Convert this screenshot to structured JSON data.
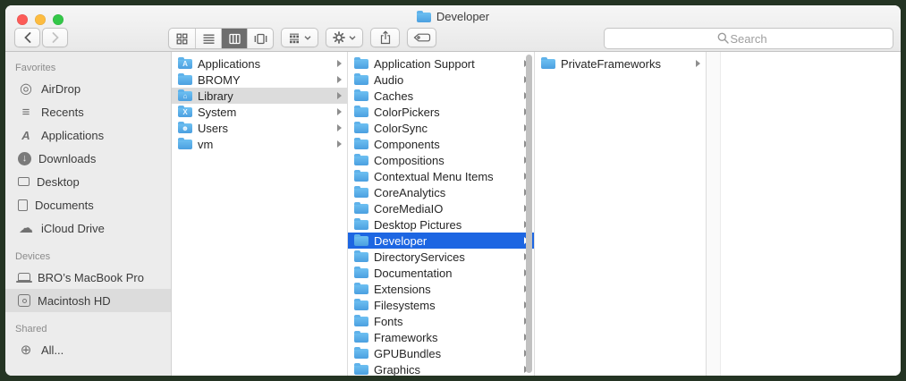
{
  "window": {
    "title": "Developer"
  },
  "traffic_lights": {
    "close": "#fc5b57",
    "minimize": "#fdbc40",
    "zoom": "#33c748"
  },
  "toolbar": {
    "view_modes": [
      {
        "name": "icons",
        "selected": false
      },
      {
        "name": "list",
        "selected": false
      },
      {
        "name": "columns",
        "selected": true
      },
      {
        "name": "gallery",
        "selected": false
      }
    ],
    "buttons": [
      "back",
      "forward",
      "group",
      "action",
      "share",
      "tags"
    ],
    "search": {
      "placeholder": "Search",
      "value": ""
    }
  },
  "sidebar": {
    "sections": [
      {
        "label": "Favorites",
        "items": [
          {
            "label": "AirDrop",
            "icon": "airdrop"
          },
          {
            "label": "Recents",
            "icon": "recents"
          },
          {
            "label": "Applications",
            "icon": "applications"
          },
          {
            "label": "Downloads",
            "icon": "downloads"
          },
          {
            "label": "Desktop",
            "icon": "desktop"
          },
          {
            "label": "Documents",
            "icon": "documents"
          },
          {
            "label": "iCloud Drive",
            "icon": "icloud"
          }
        ]
      },
      {
        "label": "Devices",
        "items": [
          {
            "label": "BRO’s MacBook Pro",
            "icon": "laptop"
          },
          {
            "label": "Macintosh HD",
            "icon": "hdd",
            "selected": true
          }
        ]
      },
      {
        "label": "Shared",
        "items": [
          {
            "label": "All...",
            "icon": "globe"
          }
        ]
      }
    ]
  },
  "icon_glyphs": {
    "airdrop": "◎",
    "recents": "≡",
    "applications": "A",
    "downloads": "↓",
    "icloud": "☁",
    "globe": "⊕"
  },
  "columns": [
    {
      "scrollbar": false,
      "items": [
        {
          "name": "Applications",
          "glyph": "A"
        },
        {
          "name": "BROMY"
        },
        {
          "name": "Library",
          "glyph": "⌂",
          "selected": "inactive"
        },
        {
          "name": "System",
          "glyph": "X"
        },
        {
          "name": "Users",
          "glyph": "☻"
        },
        {
          "name": "vm"
        }
      ]
    },
    {
      "scrollbar": true,
      "items": [
        {
          "name": "Application Support"
        },
        {
          "name": "Audio"
        },
        {
          "name": "Caches"
        },
        {
          "name": "ColorPickers"
        },
        {
          "name": "ColorSync"
        },
        {
          "name": "Components"
        },
        {
          "name": "Compositions"
        },
        {
          "name": "Contextual Menu Items"
        },
        {
          "name": "CoreAnalytics"
        },
        {
          "name": "CoreMediaIO"
        },
        {
          "name": "Desktop Pictures"
        },
        {
          "name": "Developer",
          "selected": "active"
        },
        {
          "name": "DirectoryServices"
        },
        {
          "name": "Documentation"
        },
        {
          "name": "Extensions"
        },
        {
          "name": "Filesystems"
        },
        {
          "name": "Fonts"
        },
        {
          "name": "Frameworks"
        },
        {
          "name": "GPUBundles"
        },
        {
          "name": "Graphics"
        }
      ]
    },
    {
      "scrollbar": false,
      "items": [
        {
          "name": "PrivateFrameworks"
        }
      ]
    }
  ],
  "colors": {
    "selection_blue": "#1d66e2",
    "selection_gray": "#dcdcdc",
    "folder_blue": "#5fb2ea",
    "window_frame": "#243423",
    "titlebar": "#ededed",
    "sidebar_bg": "#ececec"
  }
}
